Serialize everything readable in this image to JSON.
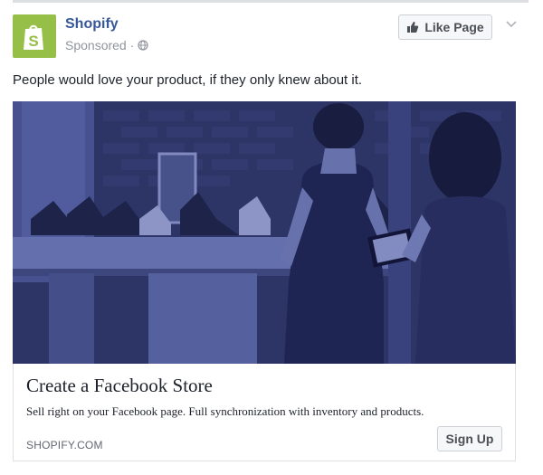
{
  "page": {
    "name": "Shopify",
    "sponsored": "Sponsored ·"
  },
  "actions": {
    "like_label": "Like Page",
    "signup_label": "Sign Up"
  },
  "post": {
    "message": "People would love your product, if they only knew about it."
  },
  "link_card": {
    "title": "Create a Facebook Store",
    "description": "Sell right on your Facebook page. Full synchronization with inventory and products.",
    "domain": "SHOPIFY.COM"
  },
  "colors": {
    "brand_green": "#95bf47",
    "link_blue": "#365899",
    "image_tint": "#2e3668"
  },
  "icons": {
    "avatar": "shopify-bag-icon",
    "audience": "globe-icon",
    "like": "thumbs-up-icon",
    "menu": "chevron-down-icon"
  }
}
